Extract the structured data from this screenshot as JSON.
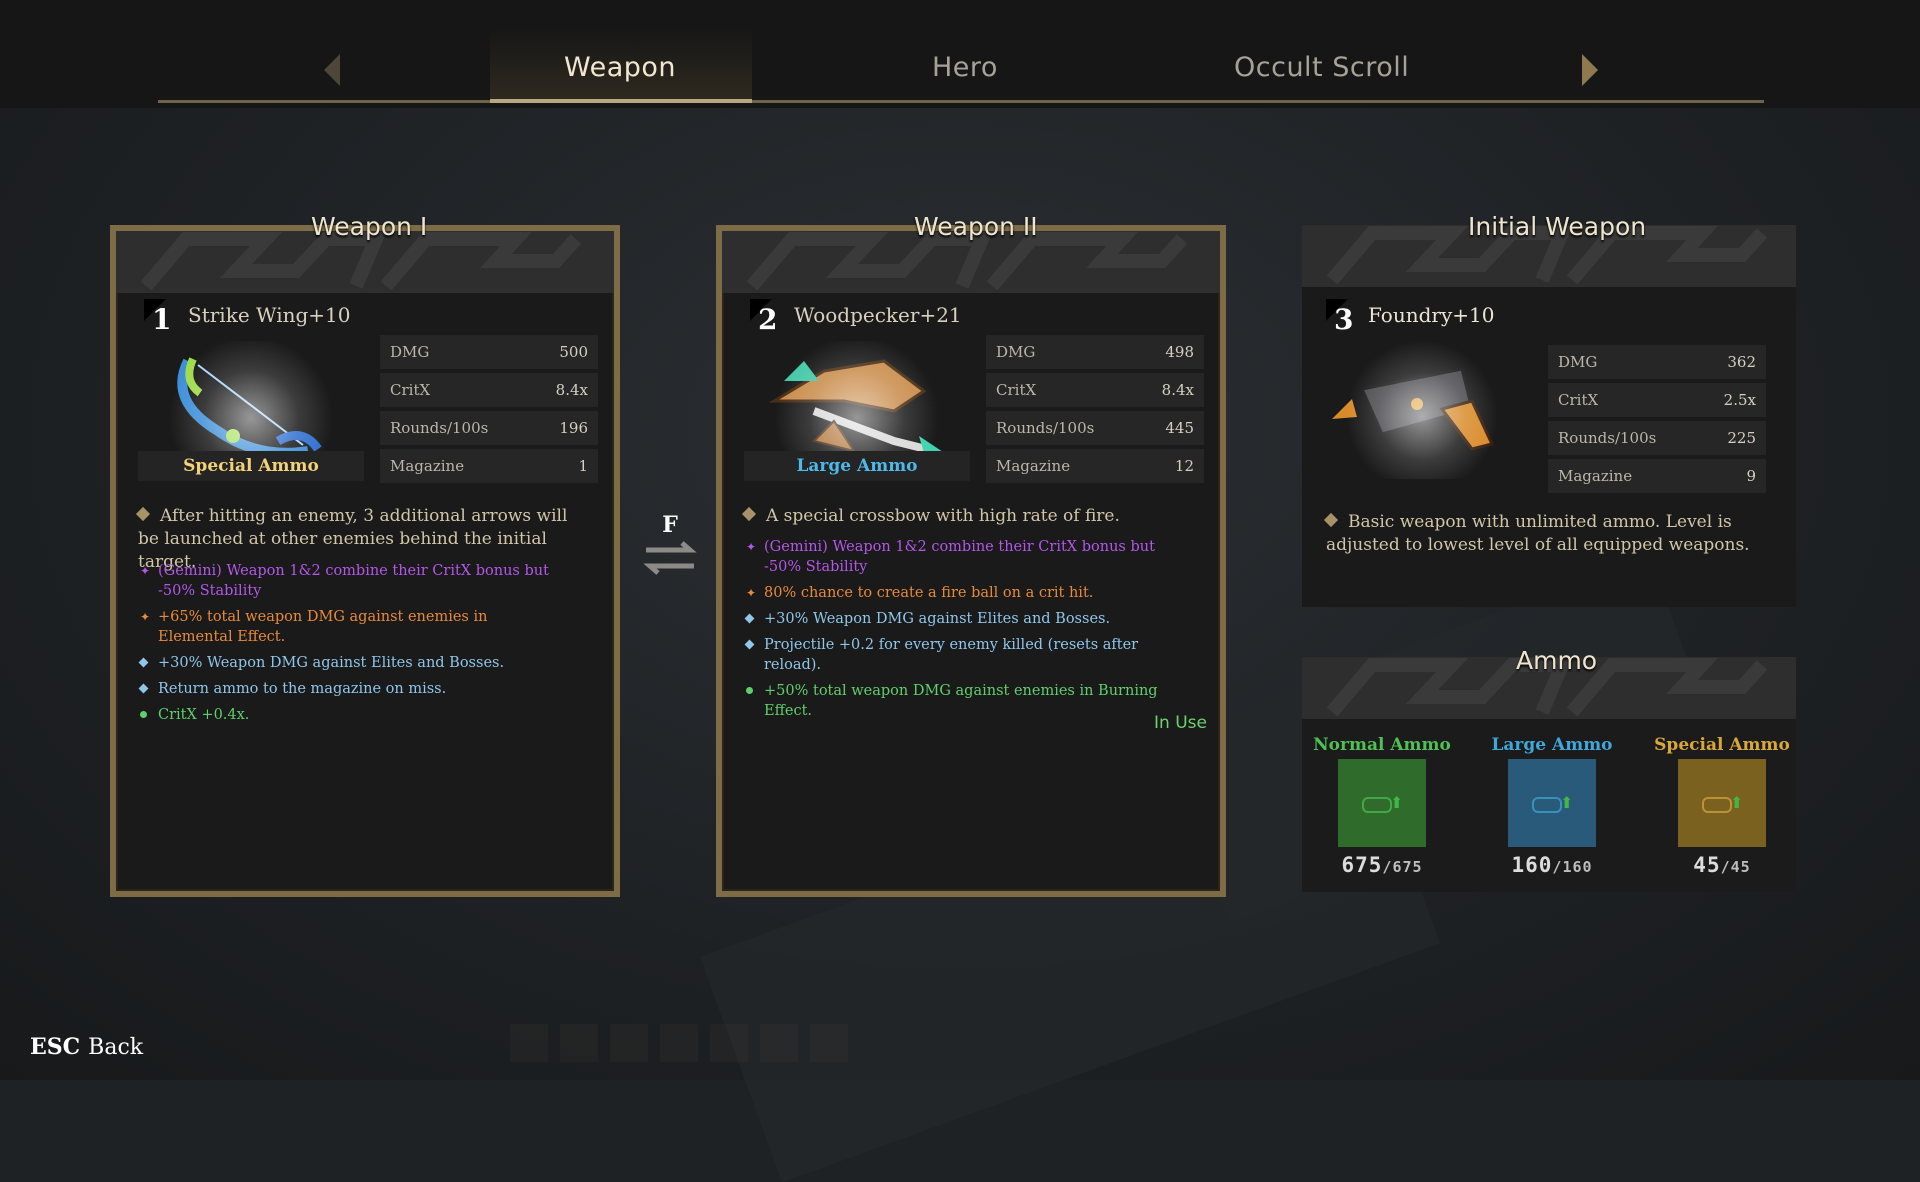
{
  "tabs": [
    {
      "label": "Weapon",
      "active": true
    },
    {
      "label": "Hero",
      "active": false
    },
    {
      "label": "Occult Scroll",
      "active": false
    }
  ],
  "weapon1": {
    "title": "Weapon I",
    "slot": "1",
    "name": "Strike Wing+10",
    "ammo_type": "Special Ammo",
    "stats": [
      {
        "label": "DMG",
        "value": "500"
      },
      {
        "label": "CritX",
        "value": "8.4x"
      },
      {
        "label": "Rounds/100s",
        "value": "196"
      },
      {
        "label": "Magazine",
        "value": "1"
      }
    ],
    "description": "After hitting an enemy, 3 additional arrows will be launched at other enemies behind the initial target.",
    "perks": [
      {
        "text": "(Gemini) Weapon 1&2 combine their CritX bonus but -50% Stability",
        "color": "#b257e8"
      },
      {
        "text": "+65% total weapon DMG against enemies in Elemental Effect.",
        "color": "#e88a3a"
      },
      {
        "text": "+30% Weapon DMG against Elites and Bosses.",
        "color": "#8fc6ea"
      },
      {
        "text": "Return ammo to the magazine on miss.",
        "color": "#8fc6ea"
      },
      {
        "text": "CritX +0.4x.",
        "color": "#5fcf6b"
      }
    ]
  },
  "weapon2": {
    "title": "Weapon II",
    "slot": "2",
    "name": "Woodpecker+21",
    "ammo_type": "Large Ammo",
    "stats": [
      {
        "label": "DMG",
        "value": "498"
      },
      {
        "label": "CritX",
        "value": "8.4x"
      },
      {
        "label": "Rounds/100s",
        "value": "445"
      },
      {
        "label": "Magazine",
        "value": "12"
      }
    ],
    "description": "A special crossbow with high rate of fire.",
    "perks": [
      {
        "text": "(Gemini) Weapon 1&2 combine their CritX bonus but -50% Stability",
        "color": "#b257e8"
      },
      {
        "text": "80% chance to create a fire ball on a crit hit.",
        "color": "#e88a3a"
      },
      {
        "text": "+30% Weapon DMG against Elites and Bosses.",
        "color": "#8fc6ea"
      },
      {
        "text": "Projectile +0.2 for every enemy killed (resets after reload).",
        "color": "#8fc6ea"
      },
      {
        "text": "+50% total weapon DMG against enemies in Burning Effect.",
        "color": "#5fcf6b"
      }
    ],
    "status": "In Use"
  },
  "swap_key": "F",
  "initial": {
    "title": "Initial Weapon",
    "slot": "3",
    "name": "Foundry+10",
    "stats": [
      {
        "label": "DMG",
        "value": "362"
      },
      {
        "label": "CritX",
        "value": "2.5x"
      },
      {
        "label": "Rounds/100s",
        "value": "225"
      },
      {
        "label": "Magazine",
        "value": "9"
      }
    ],
    "description": "Basic weapon with unlimited ammo. Level is adjusted to lowest level of all equipped weapons."
  },
  "ammo": {
    "title": "Ammo",
    "slots": [
      {
        "name": "Normal Ammo",
        "current": "675",
        "max": "675",
        "color": "#4fbf56",
        "box": "#2f6b2a"
      },
      {
        "name": "Large Ammo",
        "current": "160",
        "max": "160",
        "color": "#3fa7d9",
        "box": "#2a5a79"
      },
      {
        "name": "Special Ammo",
        "current": "45",
        "max": "45",
        "color": "#d8a83a",
        "box": "#7a611f"
      }
    ]
  },
  "footer": {
    "key": "ESC",
    "label": "Back"
  }
}
